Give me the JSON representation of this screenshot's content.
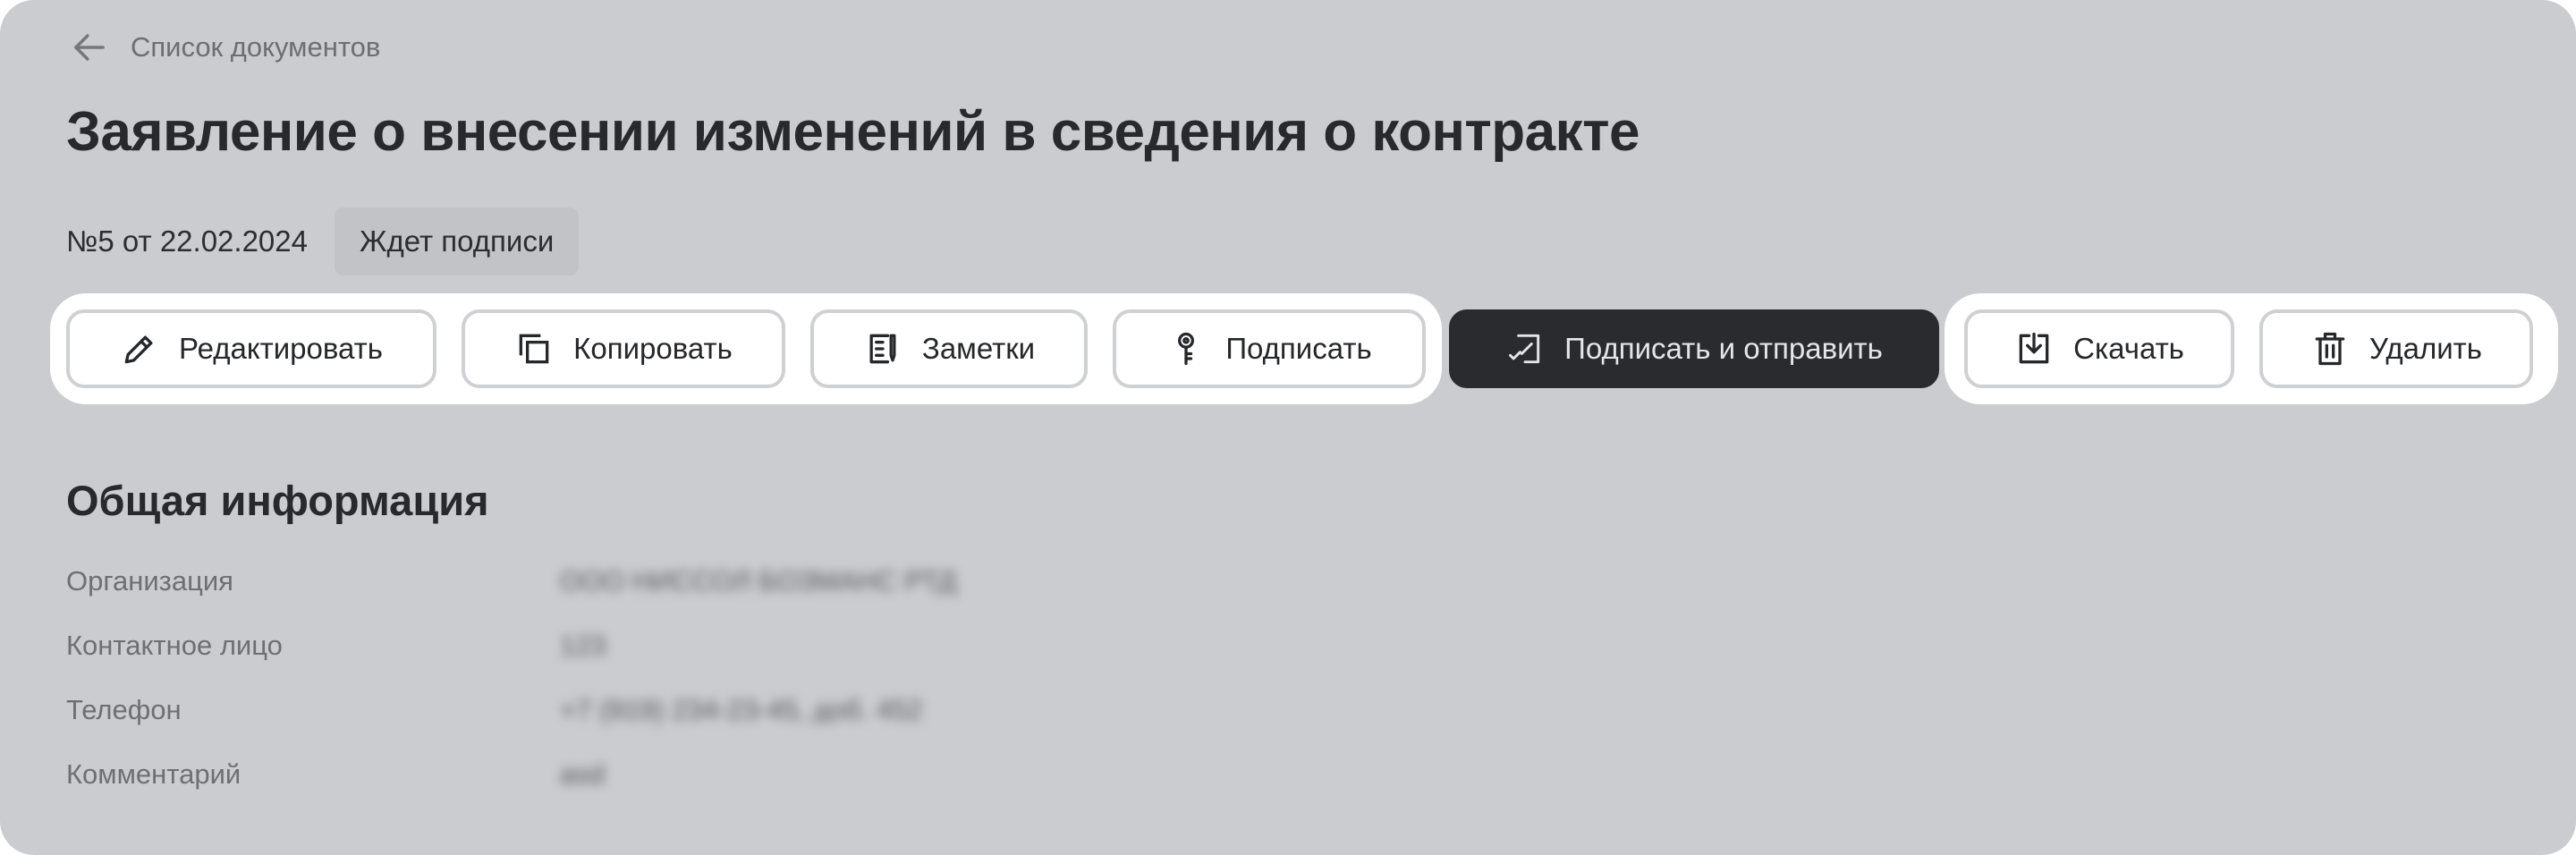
{
  "nav": {
    "back_label": "Список документов"
  },
  "document": {
    "title": "Заявление о внесении изменений в сведения о контракте",
    "number_date": "№5 от 22.02.2024",
    "status": "Ждет подписи"
  },
  "actions": {
    "edit": "Редактировать",
    "copy": "Копировать",
    "notes": "Заметки",
    "sign": "Подписать",
    "sign_send": "Подписать и отправить",
    "download": "Скачать",
    "delete": "Удалить"
  },
  "info": {
    "title": "Общая информация",
    "rows": [
      {
        "label": "Организация",
        "value": "ООО НИССОЛ БОЗМАНС РТД"
      },
      {
        "label": "Контактное лицо",
        "value": "123"
      },
      {
        "label": "Телефон",
        "value": "+7 (919) 234-23-45, доб. 452"
      },
      {
        "label": "Комментарий",
        "value": "asd"
      }
    ]
  }
}
